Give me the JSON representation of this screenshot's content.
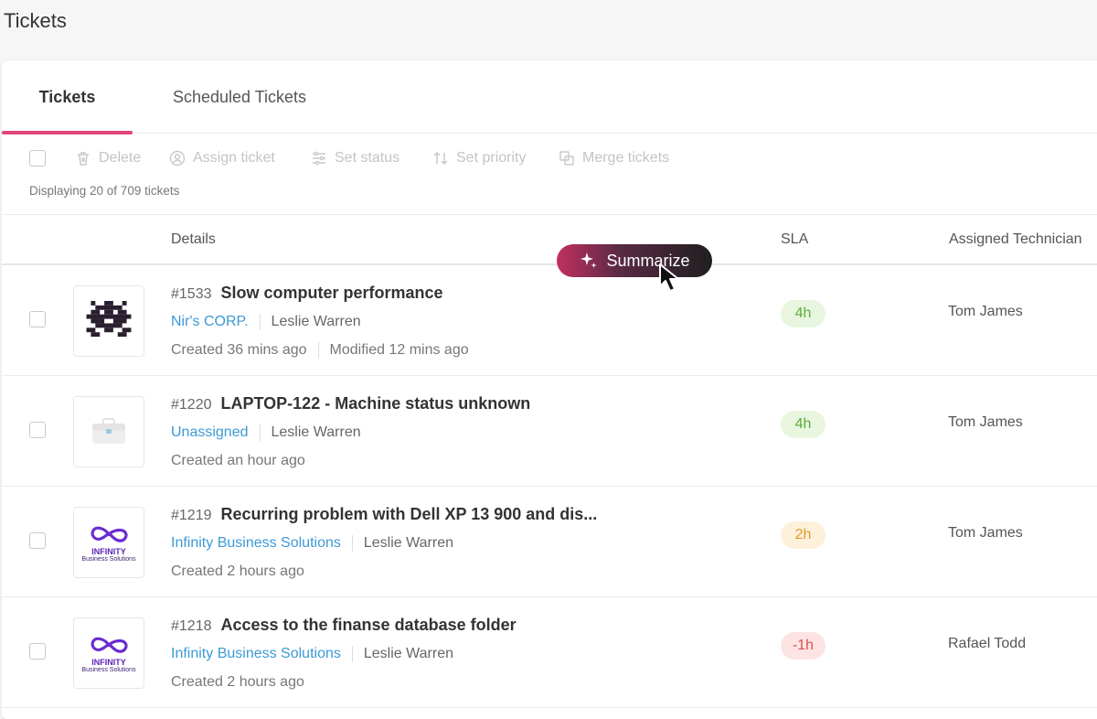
{
  "page_title": "Tickets",
  "tabs": [
    {
      "label": "Tickets",
      "active": true
    },
    {
      "label": "Scheduled Tickets",
      "active": false
    }
  ],
  "toolbar": {
    "delete": "Delete",
    "assign": "Assign ticket",
    "status": "Set status",
    "priority": "Set priority",
    "merge": "Merge tickets"
  },
  "count_text": "Displaying 20 of 709 tickets",
  "columns": {
    "details": "Details",
    "sla": "SLA",
    "technician": "Assigned Technician"
  },
  "summarize_label": "Summarize",
  "colors": {
    "accent": "#e0457b",
    "link": "#3c9ad4",
    "sla_green_bg": "#e8f6df",
    "sla_green_fg": "#5cac3a",
    "sla_orange_bg": "#fdf1dc",
    "sla_orange_fg": "#e39a2c",
    "sla_red_bg": "#fde4e4",
    "sla_red_fg": "#d9534f"
  },
  "rows": [
    {
      "id": "#1533",
      "title": "Slow computer performance",
      "company": "Nir's CORP.",
      "contact": "Leslie Warren",
      "created": "Created 36 mins ago",
      "modified": "Modified 12 mins ago",
      "sla": "4h",
      "sla_status": "green",
      "technician": "Tom James",
      "logo": "pixel-invader-logo"
    },
    {
      "id": "#1220",
      "title": "LAPTOP-122 - Machine status unknown",
      "company": "Unassigned",
      "contact": "Leslie Warren",
      "created": "Created an hour ago",
      "modified": "",
      "sla": "4h",
      "sla_status": "green",
      "technician": "Tom James",
      "logo": "toolbox-icon"
    },
    {
      "id": "#1219",
      "title": "Recurring problem with Dell XP 13 900 and dis...",
      "company": "Infinity Business Solutions",
      "contact": "Leslie Warren",
      "created": "Created 2 hours ago",
      "modified": "",
      "sla": "2h",
      "sla_status": "orange",
      "technician": "Tom James",
      "logo": "infinity-logo",
      "logo_text": "INFINITY",
      "logo_subtext": "Business Solutions"
    },
    {
      "id": "#1218",
      "title": "Access to the finanse database folder",
      "company": "Infinity Business Solutions",
      "contact": "Leslie Warren",
      "created": "Created 2 hours ago",
      "modified": "",
      "sla": "-1h",
      "sla_status": "red",
      "technician": "Rafael Todd",
      "logo": "infinity-logo",
      "logo_text": "INFINITY",
      "logo_subtext": "Business Solutions"
    }
  ]
}
